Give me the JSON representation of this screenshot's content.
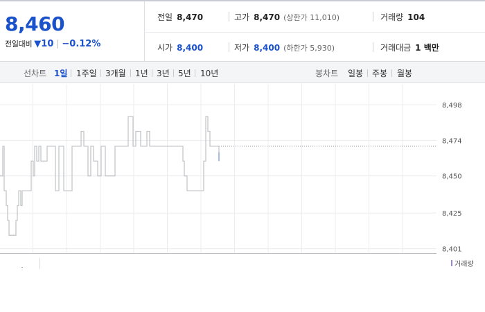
{
  "quote": {
    "price": "8,460",
    "change_label": "전일대비",
    "change_arrow": "▼",
    "change_value": "10",
    "change_pct": "−0.12%"
  },
  "stats": {
    "prev_close": {
      "label": "전일",
      "value": "8,470"
    },
    "high": {
      "label": "고가",
      "value": "8,470",
      "note": "(상한가 11,010)"
    },
    "volume": {
      "label": "거래량",
      "value": "104"
    },
    "open": {
      "label": "시가",
      "value": "8,400"
    },
    "low": {
      "label": "저가",
      "value": "8,400",
      "note": "(하한가 5,930)"
    },
    "trade_value": {
      "label": "거래대금",
      "value": "1 백만"
    }
  },
  "toolbar": {
    "line_chart_label": "선차트",
    "line_periods": [
      {
        "label": "1일",
        "selected": true
      },
      {
        "label": "1주일",
        "selected": false
      },
      {
        "label": "3개월",
        "selected": false
      },
      {
        "label": "1년",
        "selected": false
      },
      {
        "label": "3년",
        "selected": false
      },
      {
        "label": "5년",
        "selected": false
      },
      {
        "label": "10년",
        "selected": false
      }
    ],
    "candle_chart_label": "봉차트",
    "candle_periods": [
      {
        "label": "일봉"
      },
      {
        "label": "주봉"
      },
      {
        "label": "월봉"
      }
    ]
  },
  "chart_data": {
    "type": "line",
    "title": "",
    "xlabel": "",
    "ylabel": "",
    "y_ticks": [
      "8,498",
      "8,474",
      "8,450",
      "8,425",
      "8,401"
    ],
    "y_tick_values": [
      8498,
      8474,
      8450,
      8425,
      8401
    ],
    "ylim": [
      8398,
      8512
    ],
    "xlim": [
      0,
      630
    ],
    "grid": true,
    "reference_line": {
      "value": 8470,
      "style": "dotted"
    },
    "series": [
      {
        "points": [
          [
            0,
            8450
          ],
          [
            4,
            8450
          ],
          [
            4,
            8470
          ],
          [
            6,
            8470
          ],
          [
            6,
            8440
          ],
          [
            9,
            8440
          ],
          [
            9,
            8430
          ],
          [
            11,
            8430
          ],
          [
            11,
            8420
          ],
          [
            13,
            8420
          ],
          [
            13,
            8410
          ],
          [
            23,
            8410
          ],
          [
            23,
            8420
          ],
          [
            25,
            8420
          ],
          [
            25,
            8430
          ],
          [
            27,
            8430
          ],
          [
            27,
            8440
          ],
          [
            30,
            8440
          ],
          [
            30,
            8430
          ],
          [
            32,
            8430
          ],
          [
            32,
            8440
          ],
          [
            45,
            8440
          ],
          [
            45,
            8460
          ],
          [
            48,
            8460
          ],
          [
            48,
            8450
          ],
          [
            50,
            8450
          ],
          [
            50,
            8470
          ],
          [
            53,
            8470
          ],
          [
            53,
            8460
          ],
          [
            56,
            8460
          ],
          [
            56,
            8470
          ],
          [
            59,
            8470
          ],
          [
            59,
            8460
          ],
          [
            68,
            8460
          ],
          [
            68,
            8470
          ],
          [
            80,
            8470
          ],
          [
            80,
            8440
          ],
          [
            85,
            8440
          ],
          [
            85,
            8470
          ],
          [
            92,
            8470
          ],
          [
            92,
            8440
          ],
          [
            104,
            8440
          ],
          [
            104,
            8470
          ],
          [
            117,
            8470
          ],
          [
            117,
            8480
          ],
          [
            121,
            8480
          ],
          [
            121,
            8470
          ],
          [
            127,
            8470
          ],
          [
            127,
            8450
          ],
          [
            131,
            8450
          ],
          [
            131,
            8470
          ],
          [
            135,
            8470
          ],
          [
            135,
            8460
          ],
          [
            141,
            8460
          ],
          [
            141,
            8450
          ],
          [
            146,
            8450
          ],
          [
            146,
            8470
          ],
          [
            152,
            8470
          ],
          [
            152,
            8450
          ],
          [
            166,
            8450
          ],
          [
            166,
            8470
          ],
          [
            185,
            8470
          ],
          [
            185,
            8490
          ],
          [
            192,
            8490
          ],
          [
            192,
            8470
          ],
          [
            196,
            8470
          ],
          [
            196,
            8480
          ],
          [
            203,
            8480
          ],
          [
            203,
            8470
          ],
          [
            212,
            8470
          ],
          [
            212,
            8480
          ],
          [
            216,
            8480
          ],
          [
            216,
            8470
          ],
          [
            264,
            8470
          ],
          [
            264,
            8460
          ],
          [
            266,
            8460
          ],
          [
            266,
            8450
          ],
          [
            270,
            8450
          ],
          [
            270,
            8440
          ],
          [
            294,
            8440
          ],
          [
            294,
            8460
          ],
          [
            297,
            8460
          ],
          [
            297,
            8490
          ],
          [
            300,
            8490
          ],
          [
            300,
            8480
          ],
          [
            303,
            8480
          ],
          [
            303,
            8470
          ],
          [
            316,
            8470
          ],
          [
            316,
            8460
          ]
        ]
      }
    ],
    "volume_legend": "거래량"
  }
}
